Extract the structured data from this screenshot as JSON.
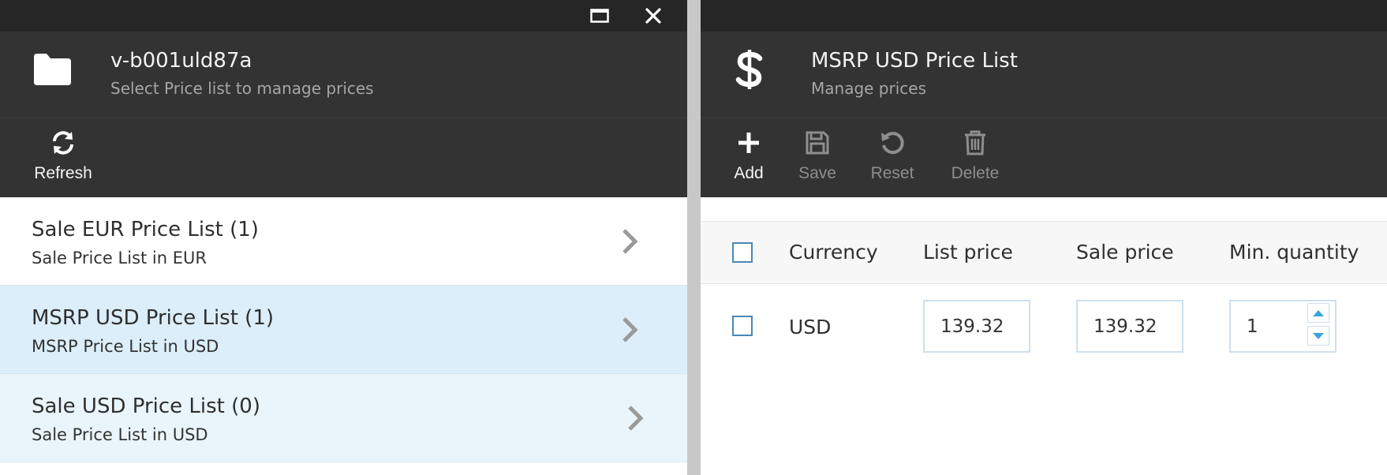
{
  "left_blade": {
    "title": "v-b001uld87a",
    "subtitle": "Select Price list to manage prices",
    "head_icon": "folder-icon",
    "toolbar": {
      "refresh_label": "Refresh",
      "refresh_icon": "refresh-icon"
    },
    "window_controls": {
      "maximize_icon": "maximize-icon",
      "close_icon": "close-icon"
    },
    "items": [
      {
        "title": "Sale EUR Price List (1)",
        "subtitle": "Sale Price List in EUR",
        "state": "normal"
      },
      {
        "title": "MSRP USD Price List (1)",
        "subtitle": "MSRP Price List in USD",
        "state": "selected"
      },
      {
        "title": "Sale USD Price List (0)",
        "subtitle": "Sale Price List in USD",
        "state": "hover"
      }
    ]
  },
  "right_blade": {
    "title": "MSRP USD Price List",
    "subtitle": "Manage prices",
    "head_icon": "dollar-icon",
    "toolbar": {
      "add_label": "Add",
      "save_label": "Save",
      "reset_label": "Reset",
      "delete_label": "Delete"
    },
    "table": {
      "columns": [
        "Currency",
        "List price",
        "Sale price",
        "Min. quantity"
      ],
      "rows": [
        {
          "currency": "USD",
          "list_price": "139.32",
          "sale_price": "139.32",
          "min_quantity": "1"
        }
      ]
    }
  },
  "colors": {
    "dark_header": "#333333",
    "top_bar": "#262626",
    "selected_row": "#dbeef9",
    "hover_row": "#eaf5fb",
    "accent": "#4a89b8"
  }
}
